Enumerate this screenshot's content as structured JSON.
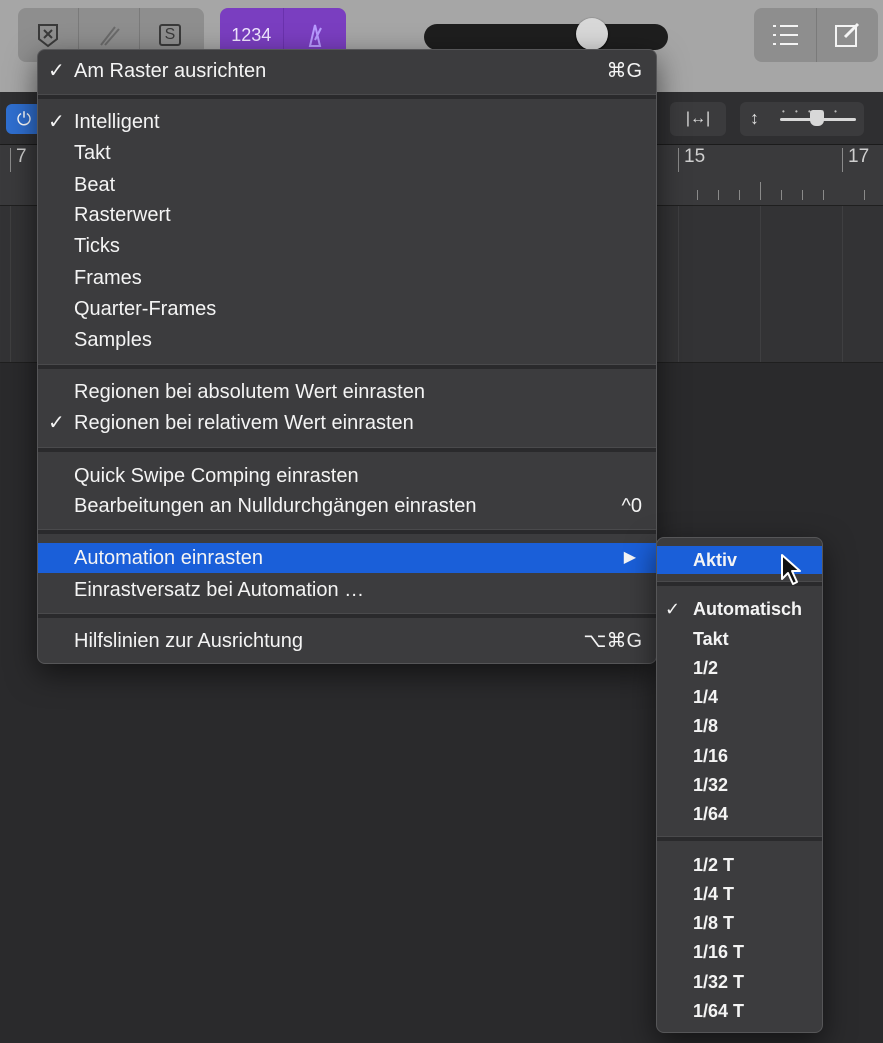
{
  "toolbar": {
    "left_buttons": [
      {
        "icon": "close-x-icon"
      },
      {
        "icon": "tuning-fork-icon"
      },
      {
        "icon": "solo-s-icon",
        "text": "S"
      }
    ],
    "lcd_button": {
      "text": "1234"
    },
    "metronome_icon": "metronome-icon",
    "right_buttons": [
      {
        "icon": "list-icon"
      },
      {
        "icon": "edit-note-icon"
      }
    ]
  },
  "ruler": {
    "bars": [
      "7",
      "15",
      "17"
    ]
  },
  "main_menu": {
    "items": [
      {
        "check": "✓",
        "label": "Am Raster ausrichten",
        "shortcut": "⌘G"
      },
      {
        "check": "✓",
        "label": "Intelligent",
        "shortcut": ""
      },
      {
        "check": "",
        "label": "Takt",
        "shortcut": ""
      },
      {
        "check": "",
        "label": "Beat",
        "shortcut": ""
      },
      {
        "check": "",
        "label": "Rasterwert",
        "shortcut": ""
      },
      {
        "check": "",
        "label": "Ticks",
        "shortcut": ""
      },
      {
        "check": "",
        "label": "Frames",
        "shortcut": ""
      },
      {
        "check": "",
        "label": "Quarter-Frames",
        "shortcut": ""
      },
      {
        "check": "",
        "label": "Samples",
        "shortcut": ""
      },
      {
        "check": "",
        "label": "Regionen bei absolutem Wert einrasten",
        "shortcut": ""
      },
      {
        "check": "✓",
        "label": "Regionen bei relativem Wert einrasten",
        "shortcut": ""
      },
      {
        "check": "",
        "label": "Quick Swipe Comping einrasten",
        "shortcut": ""
      },
      {
        "check": "",
        "label": "Bearbeitungen an Nulldurchgängen einrasten",
        "shortcut": "^0"
      },
      {
        "check": "",
        "label": "Automation einrasten",
        "shortcut": "",
        "arrow": "▶"
      },
      {
        "check": "",
        "label": "Einrastversatz bei Automation …",
        "shortcut": ""
      },
      {
        "check": "",
        "label": "Hilfslinien zur Ausrichtung",
        "shortcut": "⌥⌘G"
      }
    ]
  },
  "sub_menu": {
    "items": [
      {
        "check": "",
        "label": "Aktiv"
      },
      {
        "check": "✓",
        "label": "Automatisch"
      },
      {
        "check": "",
        "label": "Takt"
      },
      {
        "check": "",
        "label": "1/2"
      },
      {
        "check": "",
        "label": "1/4"
      },
      {
        "check": "",
        "label": "1/8"
      },
      {
        "check": "",
        "label": "1/16"
      },
      {
        "check": "",
        "label": "1/32"
      },
      {
        "check": "",
        "label": "1/64"
      },
      {
        "check": "",
        "label": "1/2 T"
      },
      {
        "check": "",
        "label": "1/4 T"
      },
      {
        "check": "",
        "label": "1/8 T"
      },
      {
        "check": "",
        "label": "1/16 T"
      },
      {
        "check": "",
        "label": "1/32 T"
      },
      {
        "check": "",
        "label": "1/64 T"
      }
    ]
  },
  "colors": {
    "highlight": "#1a5fd9",
    "menu_bg": "#3c3c3e",
    "lcd_purple": "#7a3ec0",
    "power_blue": "#2f6fd0"
  }
}
